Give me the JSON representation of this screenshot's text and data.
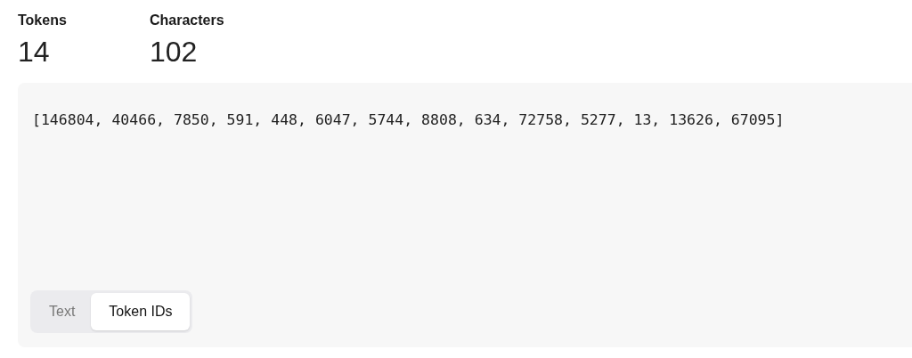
{
  "stats": [
    {
      "label": "Tokens",
      "value": "14"
    },
    {
      "label": "Characters",
      "value": "102"
    }
  ],
  "output": {
    "text": "[146804, 40466, 7850, 591, 448, 6047, 5744, 8808, 634, 72758, 5277, 13, 13626, 67095]"
  },
  "view_toggle": [
    {
      "label": "Text",
      "selected": false
    },
    {
      "label": "Token IDs",
      "selected": true
    }
  ]
}
